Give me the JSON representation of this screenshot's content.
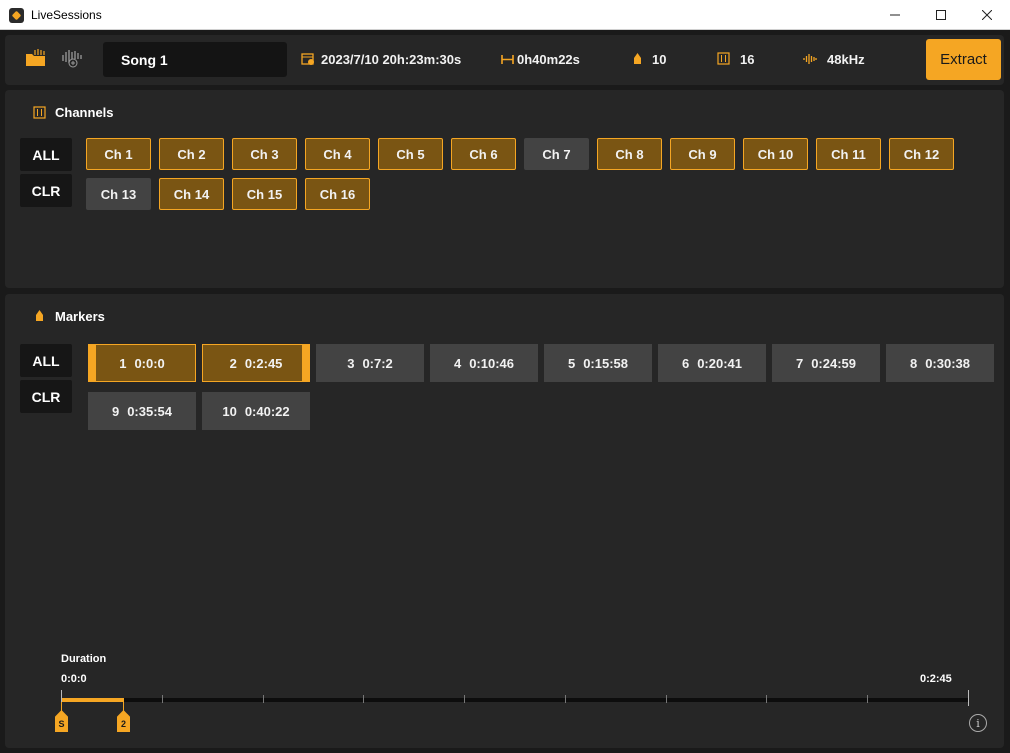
{
  "window": {
    "title": "LiveSessions"
  },
  "colors": {
    "accent": "#f5a623",
    "selected_fill": "#7a5513",
    "unselected_fill": "#434343",
    "panel": "#262626"
  },
  "toolbar": {
    "song_name": "Song 1",
    "date": "2023/7/10 20h:23m:30s",
    "length": "0h40m22s",
    "marker_count": "10",
    "channel_count": "16",
    "sample_rate": "48kHz",
    "extract_label": "Extract",
    "icons": [
      "folder-open-icon",
      "audio-device-icon",
      "calendar-icon",
      "duration-icon",
      "marker-icon",
      "channels-icon",
      "waveform-icon"
    ]
  },
  "channels": {
    "title": "Channels",
    "all_label": "ALL",
    "clr_label": "CLR",
    "items": [
      {
        "label": "Ch 1",
        "selected": true
      },
      {
        "label": "Ch 2",
        "selected": true
      },
      {
        "label": "Ch 3",
        "selected": true
      },
      {
        "label": "Ch 4",
        "selected": true
      },
      {
        "label": "Ch 5",
        "selected": true
      },
      {
        "label": "Ch 6",
        "selected": true
      },
      {
        "label": "Ch 7",
        "selected": false
      },
      {
        "label": "Ch 8",
        "selected": true
      },
      {
        "label": "Ch 9",
        "selected": true
      },
      {
        "label": "Ch 10",
        "selected": true
      },
      {
        "label": "Ch 11",
        "selected": true
      },
      {
        "label": "Ch 12",
        "selected": true
      },
      {
        "label": "Ch 13",
        "selected": false
      },
      {
        "label": "Ch 14",
        "selected": true
      },
      {
        "label": "Ch 15",
        "selected": true
      },
      {
        "label": "Ch 16",
        "selected": true
      }
    ]
  },
  "markers": {
    "title": "Markers",
    "all_label": "ALL",
    "clr_label": "CLR",
    "items": [
      {
        "num": "1",
        "time": "0:0:0",
        "selected": true
      },
      {
        "num": "2",
        "time": "0:2:45",
        "selected": true
      },
      {
        "num": "3",
        "time": "0:7:2",
        "selected": false
      },
      {
        "num": "4",
        "time": "0:10:46",
        "selected": false
      },
      {
        "num": "5",
        "time": "0:15:58",
        "selected": false
      },
      {
        "num": "6",
        "time": "0:20:41",
        "selected": false
      },
      {
        "num": "7",
        "time": "0:24:59",
        "selected": false
      },
      {
        "num": "8",
        "time": "0:30:38",
        "selected": false
      },
      {
        "num": "9",
        "time": "0:35:54",
        "selected": false
      },
      {
        "num": "10",
        "time": "0:40:22",
        "selected": false
      }
    ]
  },
  "duration": {
    "label": "Duration",
    "start": "0:0:0",
    "end": "0:2:45",
    "start_flag": "S",
    "end_flag": "2",
    "selected_fraction": 0.069
  }
}
